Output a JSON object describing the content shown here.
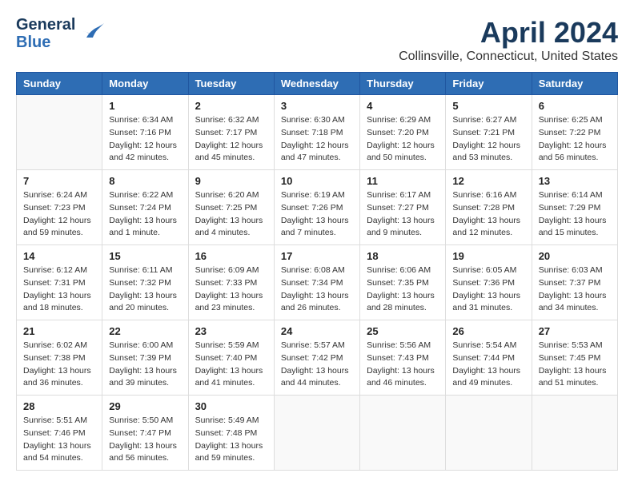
{
  "header": {
    "logo_line1": "General",
    "logo_line2": "Blue",
    "month": "April 2024",
    "location": "Collinsville, Connecticut, United States"
  },
  "weekdays": [
    "Sunday",
    "Monday",
    "Tuesday",
    "Wednesday",
    "Thursday",
    "Friday",
    "Saturday"
  ],
  "weeks": [
    [
      {
        "day": "",
        "info": ""
      },
      {
        "day": "1",
        "info": "Sunrise: 6:34 AM\nSunset: 7:16 PM\nDaylight: 12 hours\nand 42 minutes."
      },
      {
        "day": "2",
        "info": "Sunrise: 6:32 AM\nSunset: 7:17 PM\nDaylight: 12 hours\nand 45 minutes."
      },
      {
        "day": "3",
        "info": "Sunrise: 6:30 AM\nSunset: 7:18 PM\nDaylight: 12 hours\nand 47 minutes."
      },
      {
        "day": "4",
        "info": "Sunrise: 6:29 AM\nSunset: 7:20 PM\nDaylight: 12 hours\nand 50 minutes."
      },
      {
        "day": "5",
        "info": "Sunrise: 6:27 AM\nSunset: 7:21 PM\nDaylight: 12 hours\nand 53 minutes."
      },
      {
        "day": "6",
        "info": "Sunrise: 6:25 AM\nSunset: 7:22 PM\nDaylight: 12 hours\nand 56 minutes."
      }
    ],
    [
      {
        "day": "7",
        "info": "Sunrise: 6:24 AM\nSunset: 7:23 PM\nDaylight: 12 hours\nand 59 minutes."
      },
      {
        "day": "8",
        "info": "Sunrise: 6:22 AM\nSunset: 7:24 PM\nDaylight: 13 hours\nand 1 minute."
      },
      {
        "day": "9",
        "info": "Sunrise: 6:20 AM\nSunset: 7:25 PM\nDaylight: 13 hours\nand 4 minutes."
      },
      {
        "day": "10",
        "info": "Sunrise: 6:19 AM\nSunset: 7:26 PM\nDaylight: 13 hours\nand 7 minutes."
      },
      {
        "day": "11",
        "info": "Sunrise: 6:17 AM\nSunset: 7:27 PM\nDaylight: 13 hours\nand 9 minutes."
      },
      {
        "day": "12",
        "info": "Sunrise: 6:16 AM\nSunset: 7:28 PM\nDaylight: 13 hours\nand 12 minutes."
      },
      {
        "day": "13",
        "info": "Sunrise: 6:14 AM\nSunset: 7:29 PM\nDaylight: 13 hours\nand 15 minutes."
      }
    ],
    [
      {
        "day": "14",
        "info": "Sunrise: 6:12 AM\nSunset: 7:31 PM\nDaylight: 13 hours\nand 18 minutes."
      },
      {
        "day": "15",
        "info": "Sunrise: 6:11 AM\nSunset: 7:32 PM\nDaylight: 13 hours\nand 20 minutes."
      },
      {
        "day": "16",
        "info": "Sunrise: 6:09 AM\nSunset: 7:33 PM\nDaylight: 13 hours\nand 23 minutes."
      },
      {
        "day": "17",
        "info": "Sunrise: 6:08 AM\nSunset: 7:34 PM\nDaylight: 13 hours\nand 26 minutes."
      },
      {
        "day": "18",
        "info": "Sunrise: 6:06 AM\nSunset: 7:35 PM\nDaylight: 13 hours\nand 28 minutes."
      },
      {
        "day": "19",
        "info": "Sunrise: 6:05 AM\nSunset: 7:36 PM\nDaylight: 13 hours\nand 31 minutes."
      },
      {
        "day": "20",
        "info": "Sunrise: 6:03 AM\nSunset: 7:37 PM\nDaylight: 13 hours\nand 34 minutes."
      }
    ],
    [
      {
        "day": "21",
        "info": "Sunrise: 6:02 AM\nSunset: 7:38 PM\nDaylight: 13 hours\nand 36 minutes."
      },
      {
        "day": "22",
        "info": "Sunrise: 6:00 AM\nSunset: 7:39 PM\nDaylight: 13 hours\nand 39 minutes."
      },
      {
        "day": "23",
        "info": "Sunrise: 5:59 AM\nSunset: 7:40 PM\nDaylight: 13 hours\nand 41 minutes."
      },
      {
        "day": "24",
        "info": "Sunrise: 5:57 AM\nSunset: 7:42 PM\nDaylight: 13 hours\nand 44 minutes."
      },
      {
        "day": "25",
        "info": "Sunrise: 5:56 AM\nSunset: 7:43 PM\nDaylight: 13 hours\nand 46 minutes."
      },
      {
        "day": "26",
        "info": "Sunrise: 5:54 AM\nSunset: 7:44 PM\nDaylight: 13 hours\nand 49 minutes."
      },
      {
        "day": "27",
        "info": "Sunrise: 5:53 AM\nSunset: 7:45 PM\nDaylight: 13 hours\nand 51 minutes."
      }
    ],
    [
      {
        "day": "28",
        "info": "Sunrise: 5:51 AM\nSunset: 7:46 PM\nDaylight: 13 hours\nand 54 minutes."
      },
      {
        "day": "29",
        "info": "Sunrise: 5:50 AM\nSunset: 7:47 PM\nDaylight: 13 hours\nand 56 minutes."
      },
      {
        "day": "30",
        "info": "Sunrise: 5:49 AM\nSunset: 7:48 PM\nDaylight: 13 hours\nand 59 minutes."
      },
      {
        "day": "",
        "info": ""
      },
      {
        "day": "",
        "info": ""
      },
      {
        "day": "",
        "info": ""
      },
      {
        "day": "",
        "info": ""
      }
    ]
  ]
}
